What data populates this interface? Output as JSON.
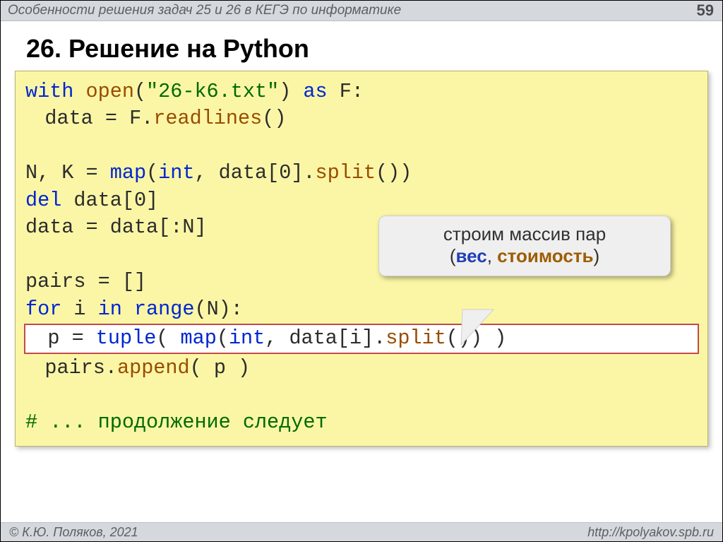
{
  "header": {
    "title": "Особенности решения задач 25 и 26 в КЕГЭ по информатике",
    "page_number": "59"
  },
  "main_title": "26. Решение на Python",
  "code": {
    "l1": {
      "a": "with ",
      "b": "open",
      "c": "(",
      "d": "\"26-k6.txt\"",
      "e": ") ",
      "f": "as",
      "g": " F:"
    },
    "l2": {
      "a": "data = F.",
      "b": "readlines",
      "c": "()"
    },
    "l3": "",
    "l4": {
      "a": "N, K = ",
      "b": "map",
      "c": "(",
      "d": "int",
      "e": ", data[",
      "f": "0",
      "g": "].",
      "h": "split",
      "i": "())"
    },
    "l5": {
      "a": "del",
      "b": " data[",
      "c": "0",
      "d": "]"
    },
    "l6": "data = data[:N]",
    "l7": "",
    "l8": "pairs = []",
    "l9": {
      "a": "for",
      "b": " i ",
      "c": "in",
      "d": " ",
      "e": "range",
      "f": "(N):"
    },
    "l10": {
      "a": "p = ",
      "b": "tuple",
      "c": "( ",
      "d": "map",
      "e": "(",
      "f": "int",
      "g": ", data[i].",
      "h": "split",
      "i": "()) )"
    },
    "l11": {
      "a": "pairs.",
      "b": "append",
      "c": "( p )"
    },
    "l12": "",
    "l13": "# ... продолжение следует"
  },
  "callout": {
    "line1": "строим массив пар",
    "open": "(",
    "w1": "вес",
    "sep": ", ",
    "w2": "стоимость",
    "close": ")"
  },
  "footer": {
    "copyright": "© К.Ю. Поляков, 2021",
    "site": "http://kpolyakov.spb.ru"
  }
}
